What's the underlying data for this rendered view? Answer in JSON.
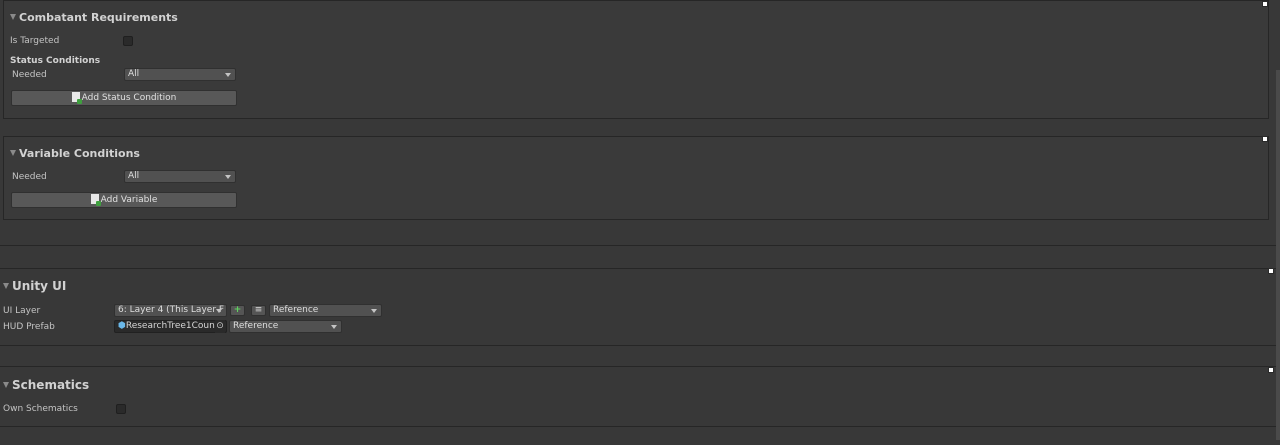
{
  "combatant": {
    "title": "Combatant Requirements",
    "is_targeted_label": "Is Targeted",
    "status_conditions_label": "Status Conditions",
    "needed_label": "Needed",
    "needed_value": "All",
    "add_button": "Add Status Condition"
  },
  "variable": {
    "title": "Variable Conditions",
    "needed_label": "Needed",
    "needed_value": "All",
    "add_button": "Add Variable"
  },
  "unity_ui": {
    "title": "Unity UI",
    "ui_layer_label": "UI Layer",
    "ui_layer_value": "6: Layer 4 (This Layer F",
    "ui_layer_mode": "Reference",
    "hud_prefab_label": "HUD Prefab",
    "hud_prefab_value": "ResearchTree1Count",
    "hud_prefab_mode": "Reference"
  },
  "schematics": {
    "title": "Schematics",
    "own_label": "Own Schematics"
  },
  "icons": [
    "foldout-triangle-icon",
    "add-document-icon",
    "prefab-cube-icon",
    "object-picker-icon",
    "add-icon",
    "menu-icon",
    "resize-handle-icon"
  ]
}
